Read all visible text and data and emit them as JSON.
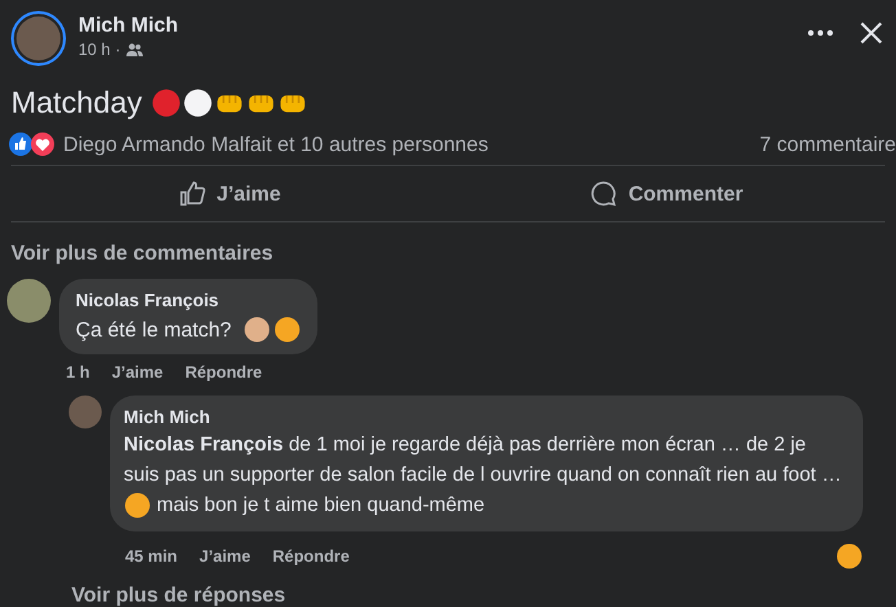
{
  "post": {
    "author": "Mich Mich",
    "time": "10 h ·",
    "text": "Matchday",
    "reactions_summary": "Diego Armando Malfait et 10 autres personnes",
    "comments_count": "7 commentaire"
  },
  "actions": [
    {
      "kind": "like",
      "label": "J’aime"
    },
    {
      "kind": "comment",
      "label": "Commenter"
    }
  ],
  "more_comments": "Voir plus de commentaires",
  "comments": [
    {
      "author": "Nicolas François",
      "text": "Ça été le match?",
      "time": "1 h",
      "like": "J’aime",
      "reply": "Répondre",
      "replies": [
        {
          "author": "Mich Mich",
          "text": "**Nicolas François** de 1 moi je regarde déjà pas derrière mon écran … de 2 je suis pas un supporter de salon facile de l ouvrire quand on connaît rien au foot …",
          "text_after": "mais bon je t aime bien quand-même",
          "time": "45 min",
          "like": "J’aime",
          "reply": "Répondre"
        }
      ]
    }
  ],
  "more_replies": "Voir plus de réponses"
}
